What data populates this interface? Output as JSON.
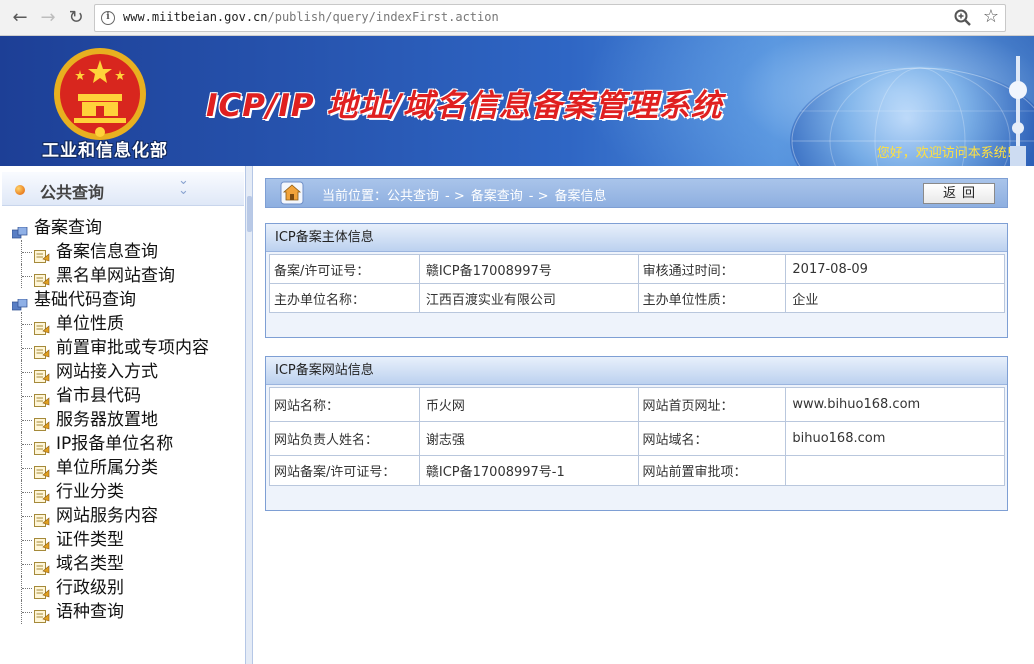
{
  "browser": {
    "url_host": "www.miitbeian.gov.cn",
    "url_path": "/publish/query/indexFirst.action"
  },
  "banner": {
    "ministry": "工业和信息化部",
    "system_title": "ICP/IP 地址/域名信息备案管理系统",
    "welcome": "您好，欢迎访问本系统!"
  },
  "sidebar": {
    "title": "公共查询",
    "groups": [
      {
        "label": "备案查询",
        "items": [
          "备案信息查询",
          "黑名单网站查询"
        ]
      },
      {
        "label": "基础代码查询",
        "items": [
          "单位性质",
          "前置审批或专项内容",
          "网站接入方式",
          "省市县代码",
          "服务器放置地",
          "IP报备单位名称",
          "单位所属分类",
          "行业分类",
          "网站服务内容",
          "证件类型",
          "域名类型",
          "行政级别",
          "语种查询"
        ]
      }
    ]
  },
  "location": {
    "prefix": "当前位置：",
    "crumbs": [
      "公共查询",
      "备案查询",
      "备案信息"
    ],
    "separator": "- >",
    "back_label": "返回"
  },
  "subject_panel": {
    "title": "ICP备案主体信息",
    "rows": [
      [
        "备案/许可证号：",
        "赣ICP备17008997号",
        "审核通过时间：",
        "2017-08-09"
      ],
      [
        "主办单位名称：",
        "江西百渡实业有限公司",
        "主办单位性质：",
        "企业"
      ]
    ]
  },
  "site_panel": {
    "title": "ICP备案网站信息",
    "rows": [
      [
        "网站名称：",
        "币火网",
        "网站首页网址：",
        "www.bihuo168.com"
      ],
      [
        "网站负责人姓名：",
        "谢志强",
        "网站域名：",
        "bihuo168.com"
      ],
      [
        "网站备案/许可证号：",
        "赣ICP备17008997号-1",
        "网站前置审批项：",
        ""
      ]
    ]
  },
  "colors": {
    "banner_blue": "#2f66c4",
    "title_red": "#e02020",
    "welcome_yellow": "#ffe040",
    "location_bar": "#a9c4ea"
  }
}
